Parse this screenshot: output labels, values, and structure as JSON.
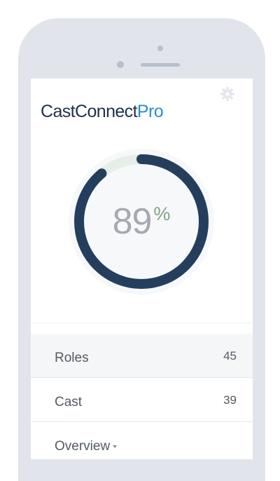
{
  "app": {
    "brand_main": "CastConnect",
    "brand_accent": "Pro"
  },
  "gauge": {
    "value": "89",
    "unit": "%",
    "fraction": 0.89,
    "track_color": "#e6eee7",
    "fill_color": "#243f5d"
  },
  "list": [
    {
      "label": "Roles",
      "count": "45"
    },
    {
      "label": "Cast",
      "count": "39"
    },
    {
      "label": "Overview",
      "count": ""
    }
  ],
  "colors": {
    "brand_text": "#1f3147",
    "brand_accent": "#2a8ed1",
    "device_frame": "#e1e4ea"
  },
  "icons": {
    "settings": "gear-icon",
    "dropdown": "chevron-down-icon"
  }
}
